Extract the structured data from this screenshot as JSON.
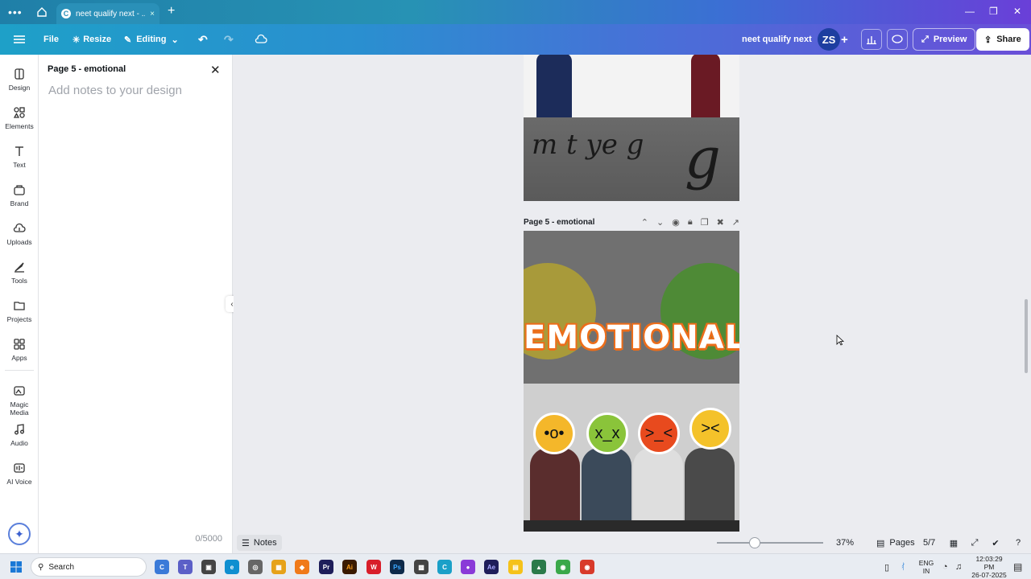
{
  "browser": {
    "tab_title": "neet qualify next - ...",
    "tab_close": "×",
    "new_tab": "+",
    "menu_dots": "•••"
  },
  "topbar": {
    "file": "File",
    "resize": "Resize",
    "editing": "Editing",
    "doc_name": "neet qualify next",
    "avatar_initials": "ZS",
    "preview": "Preview",
    "share": "Share"
  },
  "rail": {
    "items": [
      {
        "label": "Design",
        "icon": "design-icon"
      },
      {
        "label": "Elements",
        "icon": "elements-icon"
      },
      {
        "label": "Text",
        "icon": "text-icon"
      },
      {
        "label": "Brand",
        "icon": "brand-icon"
      },
      {
        "label": "Uploads",
        "icon": "uploads-icon"
      },
      {
        "label": "Tools",
        "icon": "tools-icon"
      },
      {
        "label": "Projects",
        "icon": "projects-icon"
      },
      {
        "label": "Apps",
        "icon": "apps-icon"
      },
      {
        "label": "Magic Media",
        "icon": "magic-media-icon"
      },
      {
        "label": "Audio",
        "icon": "audio-icon"
      },
      {
        "label": "AI Voice",
        "icon": "ai-voice-icon"
      }
    ]
  },
  "notes_panel": {
    "title": "Page 5 - emotional",
    "placeholder": "Add notes to your design",
    "char_count": "0/5000"
  },
  "canvas": {
    "page_label": "Page 5 - emotional",
    "title_text": "EMOTIONAL",
    "prev_page_letters": "m t ye g"
  },
  "bottombar": {
    "notes": "Notes",
    "zoom": "37%",
    "pages": "Pages",
    "page_count": "5/7",
    "zoom_level": 0.37
  },
  "taskbar": {
    "search": "Search",
    "lang_top": "ENG",
    "lang_bottom": "IN",
    "time": "12:03:29 PM",
    "date": "26-07-2025"
  },
  "colors": {
    "accent_gradient_start": "#1ea0c8",
    "accent_gradient_end": "#6a4fd8",
    "emotional_outline": "#ec6d1a"
  }
}
